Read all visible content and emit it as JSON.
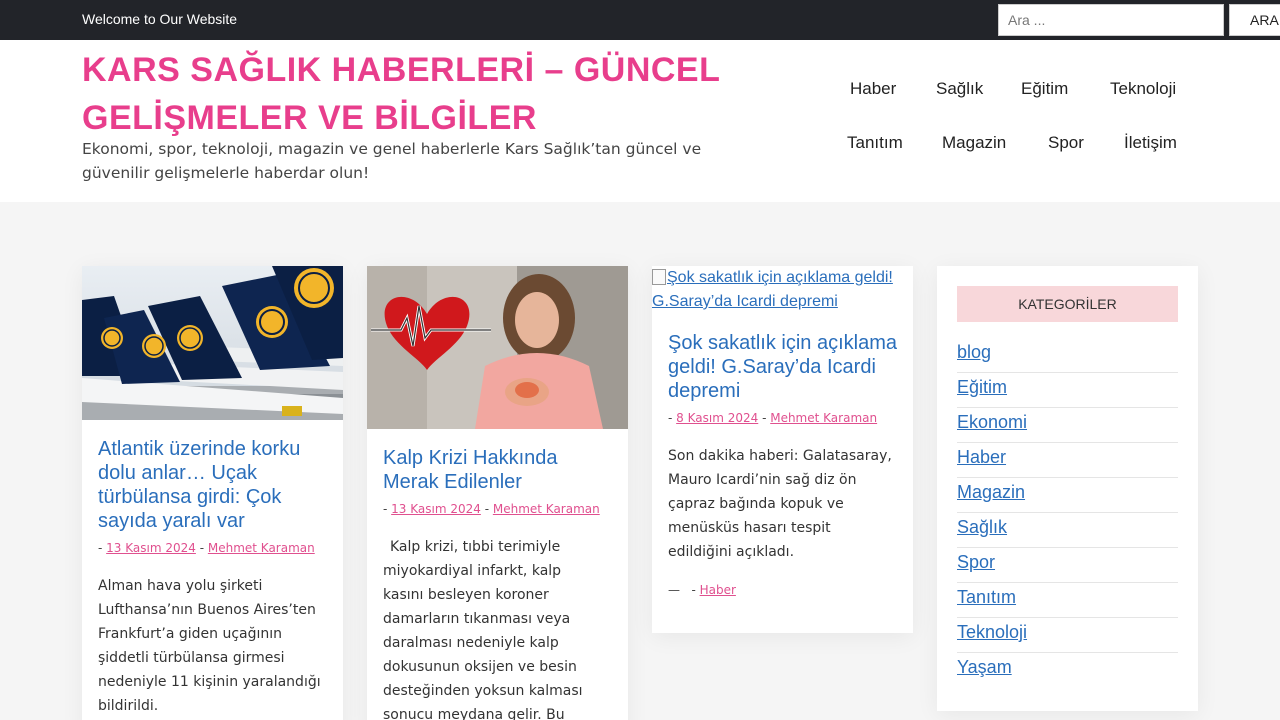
{
  "topbar": {
    "welcome": "Welcome to Our Website",
    "search_placeholder": "Ara ...",
    "search_button": "ARA"
  },
  "header": {
    "title": "KARS SAĞLIK HABERLERİ – GÜNCEL GELİŞMELER VE BİLGİLER",
    "description": "Ekonomi, spor, teknoloji, magazin ve genel haberlerle Kars Sağlık’tan güncel ve güvenilir gelişmelerle haberdar olun!"
  },
  "nav": {
    "items": [
      "Haber",
      "Sağlık",
      "Eğitim",
      "Teknoloji",
      "Tanıtım",
      "Magazin",
      "Spor",
      "İletişim"
    ]
  },
  "posts": [
    {
      "image_alt": "",
      "title": "Atlantik üzerinde korku dolu anlar… Uçak türbülansa girdi: Çok sayıda yaralı var",
      "date": "13 Kasım 2024",
      "author": "Mehmet Karaman",
      "excerpt": "Alman hava yolu şirketi Lufthansa’nın Buenos Aires’ten Frankfurt’a giden uçağının şiddetli türbülansa girmesi nedeniyle 11 kişinin yaralandığı bildirildi."
    },
    {
      "image_alt": "",
      "title": "Kalp Krizi Hakkında Merak Edilenler",
      "date": "13 Kasım 2024",
      "author": "Mehmet Karaman",
      "excerpt": "Kalp krizi, tıbbi terimiyle miyokardiyal infarkt, kalp kasını besleyen koroner damarların tıkanması veya daralması nedeniyle kalp dokusunun oksijen ve besin desteğinden yoksun kalması sonucu meydana gelir. Bu"
    },
    {
      "image_alt": "Şok sakatlık için açıklama geldi! G.Saray’da Icardi depremi",
      "title": "Şok sakatlık için açıklama geldi! G.Saray’da Icardi depremi",
      "date": "8 Kasım 2024",
      "author": "Mehmet Karaman",
      "excerpt": "Son dakika haberi: Galatasaray, Mauro Icardi’nin sağ diz ön çapraz bağında kopuk ve menüsküs hasarı tespit edildiğini açıkladı.",
      "category": "Haber"
    }
  ],
  "sidebar": {
    "title": "KATEGORİLER",
    "categories": [
      "blog",
      "Eğitim",
      "Ekonomi",
      "Haber",
      "Magazin",
      "Sağlık",
      "Spor",
      "Tanıtım",
      "Teknoloji",
      "Yaşam"
    ]
  },
  "colors": {
    "brand": "#e83e8c",
    "link": "#2a6ebb",
    "topbar_bg": "#222429",
    "widget_title_bg": "#f8d7da"
  }
}
